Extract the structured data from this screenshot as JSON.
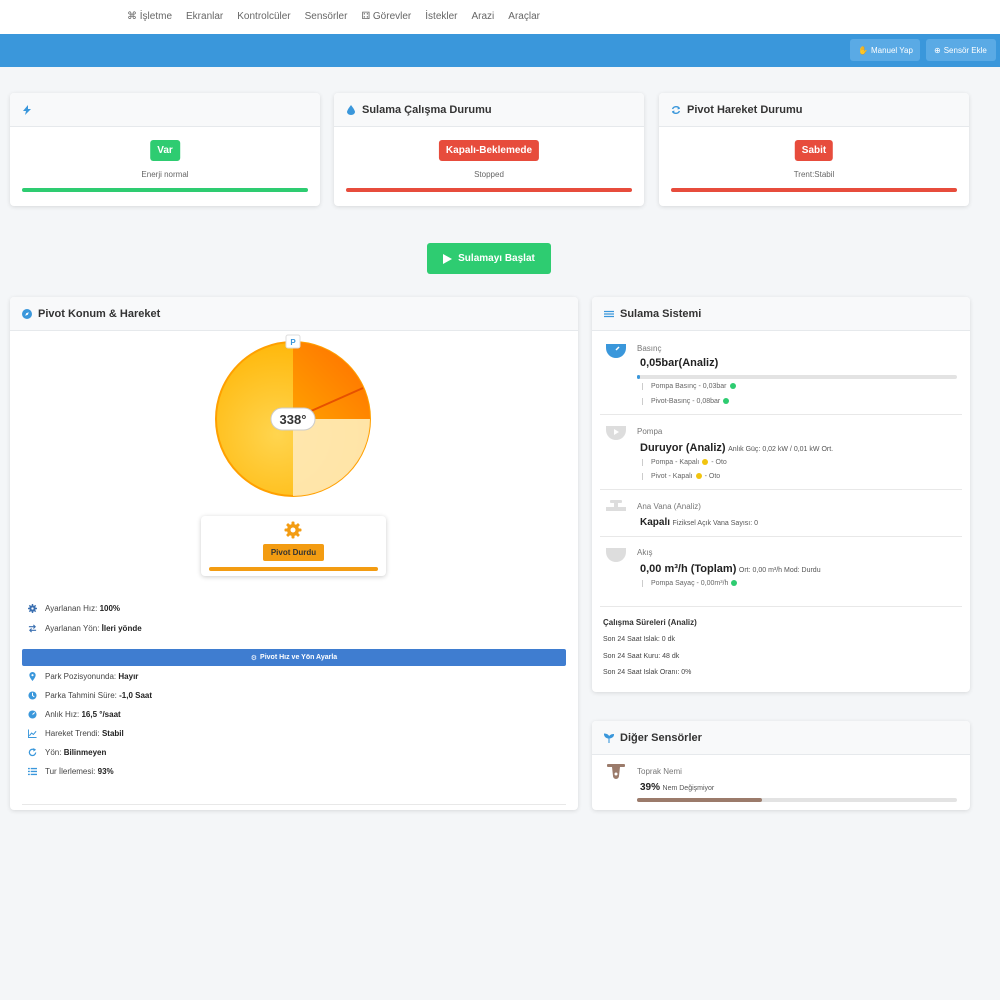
{
  "nav": {
    "items": [
      "⌘ İşletme",
      "Ekranlar",
      "Kontrolcüler",
      "Sensörler",
      "⚃ Görevler",
      "İstekler",
      "Arazi",
      "Araçlar"
    ]
  },
  "toolbar": {
    "manual_label": "Manuel Yap",
    "sensor_label": "Sensör Ekle"
  },
  "status_cards": [
    {
      "title": "",
      "badge": "Var",
      "sub": "Enerji normal",
      "color": "#2ecc71",
      "icon": "bolt-icon"
    },
    {
      "title": "Sulama Çalışma Durumu",
      "badge": "Kapalı-Beklemede",
      "sub": "Stopped",
      "color": "#e74c3c",
      "icon": "water-drop-icon"
    },
    {
      "title": "Pivot Hareket Durumu",
      "badge": "Sabit",
      "sub": "Trent:Stabil",
      "color": "#e74c3c",
      "icon": "sync-icon"
    }
  ],
  "start_button": "Sulamayı Başlat",
  "pivot": {
    "title": "Pivot Konum & Hareket",
    "angle_label": "338°",
    "angle_value": 338,
    "park_marker": "P",
    "status_label": "Pivot Durdu",
    "speed_label": "Ayarlanan Hız:",
    "speed_value": "100%",
    "direction_label": "Ayarlanan Yön:",
    "direction_value": "İleri yönde",
    "adjust_button": "Pivot Hız ve Yön Ayarla",
    "rows": [
      {
        "label": "Park Pozisyonunda:",
        "value": "Hayır",
        "icon": "map-pin-icon"
      },
      {
        "label": "Parka Tahmini Süre:",
        "value": "-1,0 Saat",
        "icon": "clock-icon"
      },
      {
        "label": "Anlık Hız:",
        "value": "16,5 °/saat",
        "icon": "speedometer-icon"
      },
      {
        "label": "Hareket Trendi:",
        "value": "Stabil",
        "icon": "trend-chart-icon"
      },
      {
        "label": "Yön:",
        "value": "Bilinmeyen",
        "icon": "rotate-icon"
      },
      {
        "label": "Tur İlerlemesi:",
        "value": "93%",
        "icon": "list-progress-icon"
      }
    ]
  },
  "irrigation": {
    "title": "Sulama Sistemi",
    "pressure": {
      "label": "Basınç",
      "value": "0,05bar(Analiz)",
      "fill": 0.01,
      "lines": [
        "Pompa Basınç - 0,03bar",
        "Pivot-Basınç - 0,08bar"
      ]
    },
    "pump": {
      "label": "Pompa",
      "value": "Duruyor (Analiz)",
      "extra": "Anlık Güç: 0,02 kW / 0,01 kW Ort.",
      "lines": [
        {
          "pre": "Pompa - Kapalı",
          "post": "- Oto"
        },
        {
          "pre": "Pivot - Kapalı",
          "post": "- Oto"
        }
      ]
    },
    "valve": {
      "label": "Ana Vana (Analiz)",
      "value": "Kapalı",
      "extra": "Fiziksel Açık Vana Sayısı: 0"
    },
    "flow": {
      "label": "Akış",
      "value": "0,00 m³/h (Toplam)",
      "extra": "Ort: 0,00 m³/h Mod: Durdu",
      "line": "Pompa Sayaç - 0,00m³/h"
    },
    "durations": {
      "title": "Çalışma Süreleri (Analiz)",
      "items": [
        "Son 24 Saat Islak: 0 dk",
        "Son 24 Saat Kuru: 48 dk",
        "Son 24 Saat Islak Oranı: 0%"
      ]
    }
  },
  "other_sensors": {
    "title": "Diğer Sensörler",
    "soil": {
      "label": "Toprak Nemi",
      "value": "39%",
      "extra": "Nem Değişmiyor",
      "fill": 0.39
    }
  },
  "colors": {
    "primary": "#3a97db",
    "success": "#2ecc71",
    "danger": "#e74c3c",
    "warning": "#f39c12",
    "pivot_field": "#ffc107",
    "pivot_adjust": "#3f7dd0"
  }
}
